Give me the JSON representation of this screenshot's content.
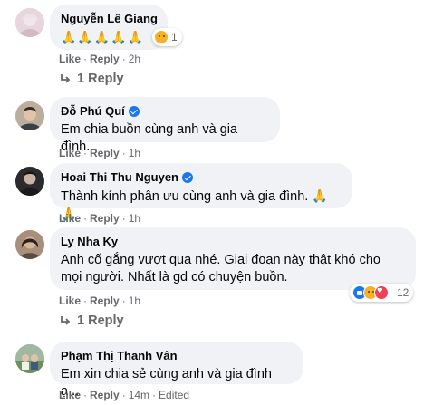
{
  "comments": [
    {
      "name": "Nguyễn Lê Giang",
      "text": "🙏🙏🙏🙏🙏",
      "reaction_count": "1",
      "like": "Like",
      "reply": "Reply",
      "time": "2h",
      "replies_label": "1 Reply"
    },
    {
      "name": "Đỗ Phú Quí",
      "text": "Em chia buồn cùng anh và gia đình.",
      "like": "Like",
      "reply": "Reply",
      "time": "1h"
    },
    {
      "name": "Hoai Thi Thu Nguyen",
      "text": "Thành kính phân ưu cùng anh và gia đình.",
      "emoji": "🙏🙏",
      "like": "Like",
      "reply": "Reply",
      "time": "1h"
    },
    {
      "name": "Ly Nha Ky",
      "text_line1": "Anh cố gắng vượt qua nhé. Giai đoạn này thật khó cho",
      "text_line2": "mọi người. Nhất là gd có chuyện buồn.",
      "reaction_count": "12",
      "like": "Like",
      "reply": "Reply",
      "time": "1h",
      "replies_label": "1 Reply"
    },
    {
      "name": "Phạm Thị Thanh Vân",
      "text": "Em xin chia sẻ cùng anh và gia đình ạ...",
      "like": "Like",
      "reply": "Reply",
      "time": "14m",
      "edited": "Edited"
    }
  ],
  "icons": {
    "verified": "verified-badge-icon",
    "reply_arrow": "reply-arrow-icon",
    "reactions": [
      "like-reaction-icon",
      "sad-reaction-icon",
      "love-reaction-icon"
    ]
  },
  "colors": {
    "bubble": "#f0f2f5",
    "secondary_text": "#65676b",
    "verified": "#1877f2"
  }
}
